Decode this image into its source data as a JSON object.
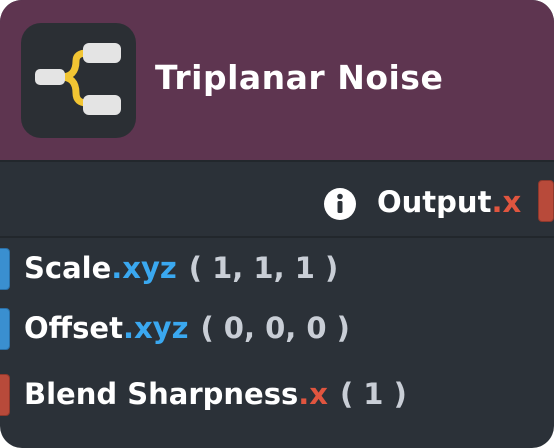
{
  "node": {
    "title": "Triplanar Noise",
    "icon": "branch-node-icon",
    "colors": {
      "header": "#5e3550",
      "body": "#2b3138",
      "vector_port": "#3a8fd0",
      "float_port": "#b84a3a"
    }
  },
  "output": {
    "name": "Output",
    "swizzle": ".x",
    "info_icon": "info-icon"
  },
  "inputs": [
    {
      "name": "Scale",
      "swizzle": ".xyz",
      "default": "( 1, 1, 1 )"
    },
    {
      "name": "Offset",
      "swizzle": ".xyz",
      "default": "( 0, 0, 0 )"
    },
    {
      "name": "Blend Sharpness",
      "swizzle": ".x",
      "default": "( 1 )"
    }
  ]
}
